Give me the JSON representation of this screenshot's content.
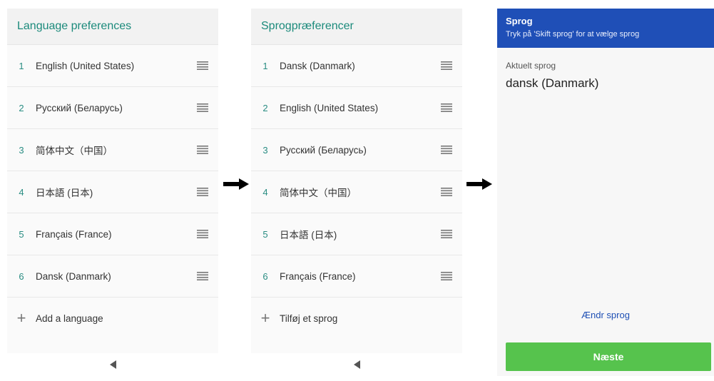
{
  "screen1": {
    "title": "Language preferences",
    "languages": [
      {
        "num": "1",
        "name": "English (United States)"
      },
      {
        "num": "2",
        "name": "Русский (Беларусь)"
      },
      {
        "num": "3",
        "name": "简体中文（中国）"
      },
      {
        "num": "4",
        "name": "日本語 (日本)"
      },
      {
        "num": "5",
        "name": "Français (France)"
      },
      {
        "num": "6",
        "name": "Dansk (Danmark)"
      }
    ],
    "add_label": "Add a language",
    "add_icon": "+"
  },
  "screen2": {
    "title": "Sprogpræferencer",
    "languages": [
      {
        "num": "1",
        "name": "Dansk (Danmark)"
      },
      {
        "num": "2",
        "name": "English (United States)"
      },
      {
        "num": "3",
        "name": "Русский (Беларусь)"
      },
      {
        "num": "4",
        "name": "简体中文（中国）"
      },
      {
        "num": "5",
        "name": "日本語 (日本)"
      },
      {
        "num": "6",
        "name": "Français (France)"
      }
    ],
    "add_label": "Tilføj et sprog",
    "add_icon": "+"
  },
  "screen3": {
    "title": "Sprog",
    "subtitle": "Tryk på 'Skift sprog' for at vælge sprog",
    "current_label": "Aktuelt sprog",
    "current_value": "dansk (Danmark)",
    "change_link": "Ændr sprog",
    "next_button": "Næste"
  },
  "colors": {
    "accent_teal": "#1b8a7b",
    "blue_header": "#1f4fb7",
    "next_green": "#56c34d"
  },
  "icons": [
    "drag-handle-icon",
    "back-icon",
    "plus-icon",
    "right-arrow-icon"
  ]
}
